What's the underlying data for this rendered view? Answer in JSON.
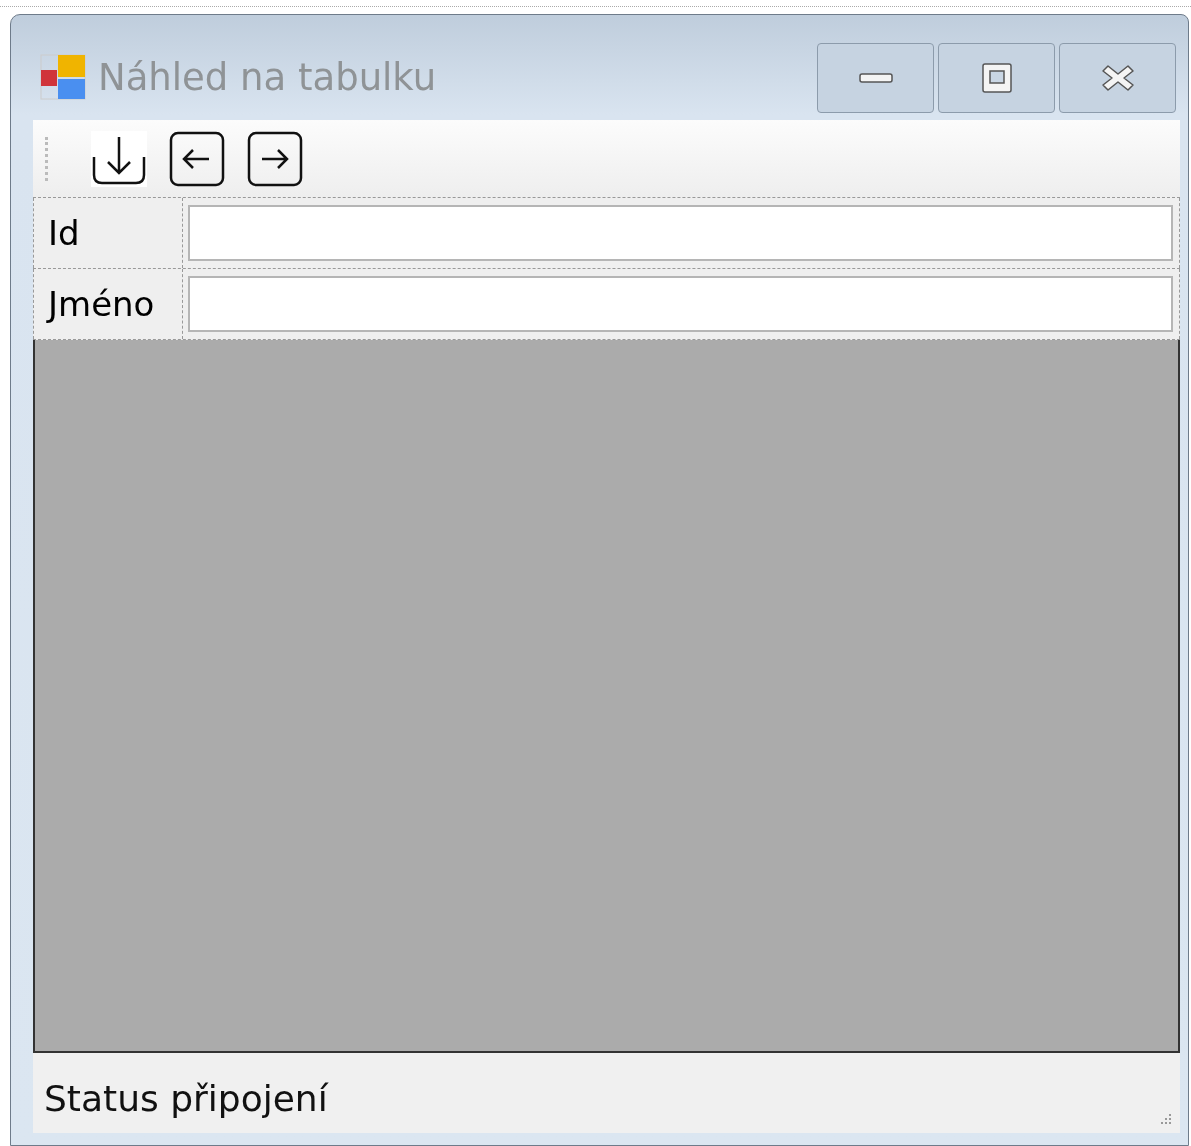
{
  "window": {
    "title": "Náhled na tabulku"
  },
  "fields": [
    {
      "label": "Id"
    },
    {
      "label": "Jméno"
    }
  ],
  "status_bar": {
    "text": "Status připojení"
  }
}
